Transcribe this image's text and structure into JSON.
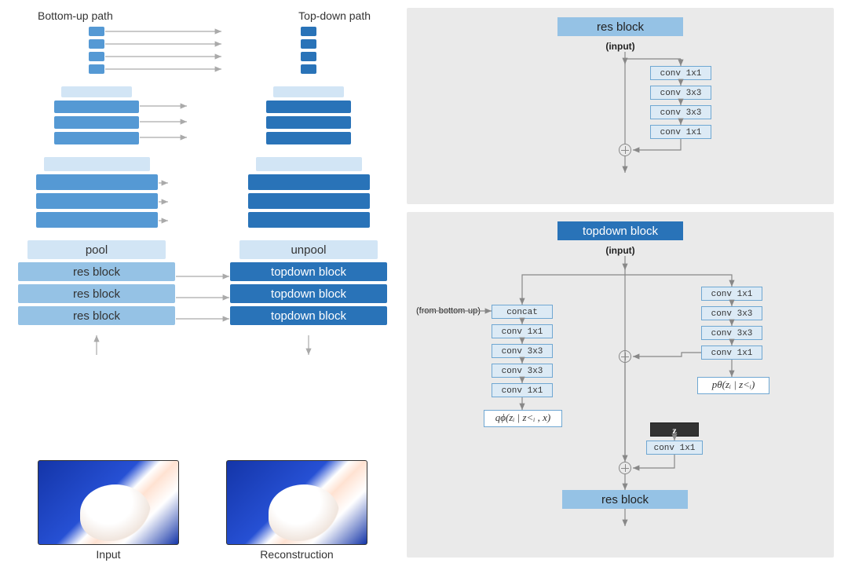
{
  "left": {
    "header_bu": "Bottom-up path",
    "header_td": "Top-down path",
    "labels": {
      "pool": "pool",
      "unpool": "unpool",
      "res_block": "res block",
      "topdown_block": "topdown block"
    },
    "captions": {
      "input": "Input",
      "reconstruction": "Reconstruction"
    }
  },
  "right": {
    "resblock": {
      "title": "res block",
      "input_label": "(input)",
      "ops": [
        "conv 1x1",
        "conv 3x3",
        "conv 3x3",
        "conv 1x1"
      ]
    },
    "tdblock": {
      "title": "topdown block",
      "input_label": "(input)",
      "from_bu_label": "(from bottom-up)",
      "left_ops": [
        "concat",
        "conv 1x1",
        "conv 3x3",
        "conv 3x3",
        "conv 1x1"
      ],
      "right_ops": [
        "conv 1x1",
        "conv 3x3",
        "conv 3x3",
        "conv 1x1"
      ],
      "q_label": "qϕ(zᵢ | z<ᵢ , x)",
      "p_label": "pθ(zᵢ | z<ᵢ)",
      "z_label": "z",
      "z_conv": "conv 1x1",
      "resblock_label": "res block"
    }
  }
}
